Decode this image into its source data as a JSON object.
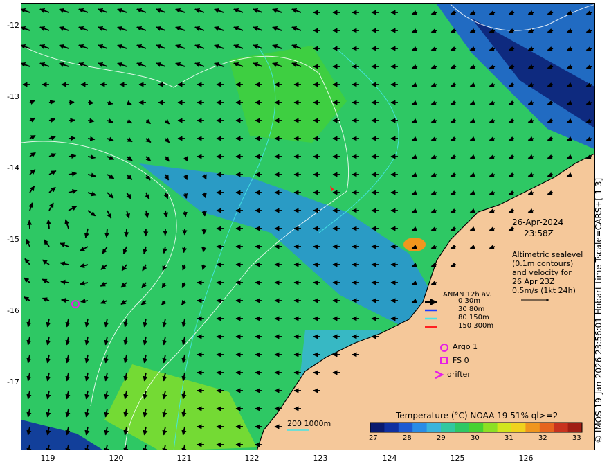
{
  "datetime": {
    "date": "26-Apr-2024",
    "time": "23:58Z"
  },
  "description": [
    "Altimetric sealevel",
    "(0.1m contours)",
    "and velocity for",
    "26 Apr 23Z",
    "0.5m/s (1kt 24h)"
  ],
  "anmn_legend": {
    "title": "ANMN 12h av.",
    "items": [
      {
        "label": "0 30m",
        "color": "#000000"
      },
      {
        "label": "30 80m",
        "color": "#1e3cff"
      },
      {
        "label": "80 150m",
        "color": "#46e6e6"
      },
      {
        "label": "150 300m",
        "color": "#ff2020"
      }
    ]
  },
  "markers": {
    "argo": "Argo 1",
    "fs": "FS 0",
    "drifter": "drifter"
  },
  "scale_note": {
    "left": "200",
    "right": "1000m"
  },
  "colorbar": {
    "title": "Temperature (°C) NOAA 19 51% ql>=2",
    "ticks": [
      "27",
      "28",
      "29",
      "30",
      "31",
      "32",
      "33"
    ],
    "colors": [
      "#0a1a6e",
      "#1030a0",
      "#1e5ad2",
      "#2a8ce6",
      "#3ab4dc",
      "#32c8a0",
      "#2ec864",
      "#46d232",
      "#8ce024",
      "#d2e61e",
      "#f0d21e",
      "#f0961e",
      "#e6641e",
      "#c8321e",
      "#a01e14"
    ]
  },
  "axes": {
    "lat_ticks": [
      "-12",
      "-13",
      "-14",
      "-15",
      "-16",
      "-17"
    ],
    "lon_ticks": [
      "119",
      "120",
      "121",
      "122",
      "123",
      "124",
      "125",
      "126"
    ]
  },
  "credit": "© IMOS 19-Jan-2026 23:56:01 Hobart time Tscale=CARS+[-1 3]",
  "colors": {
    "land": "#f5c89a",
    "ocean_mid": "#2ec864",
    "ocean_cool": "#1e5ad2",
    "argo": "#e61ee6"
  }
}
